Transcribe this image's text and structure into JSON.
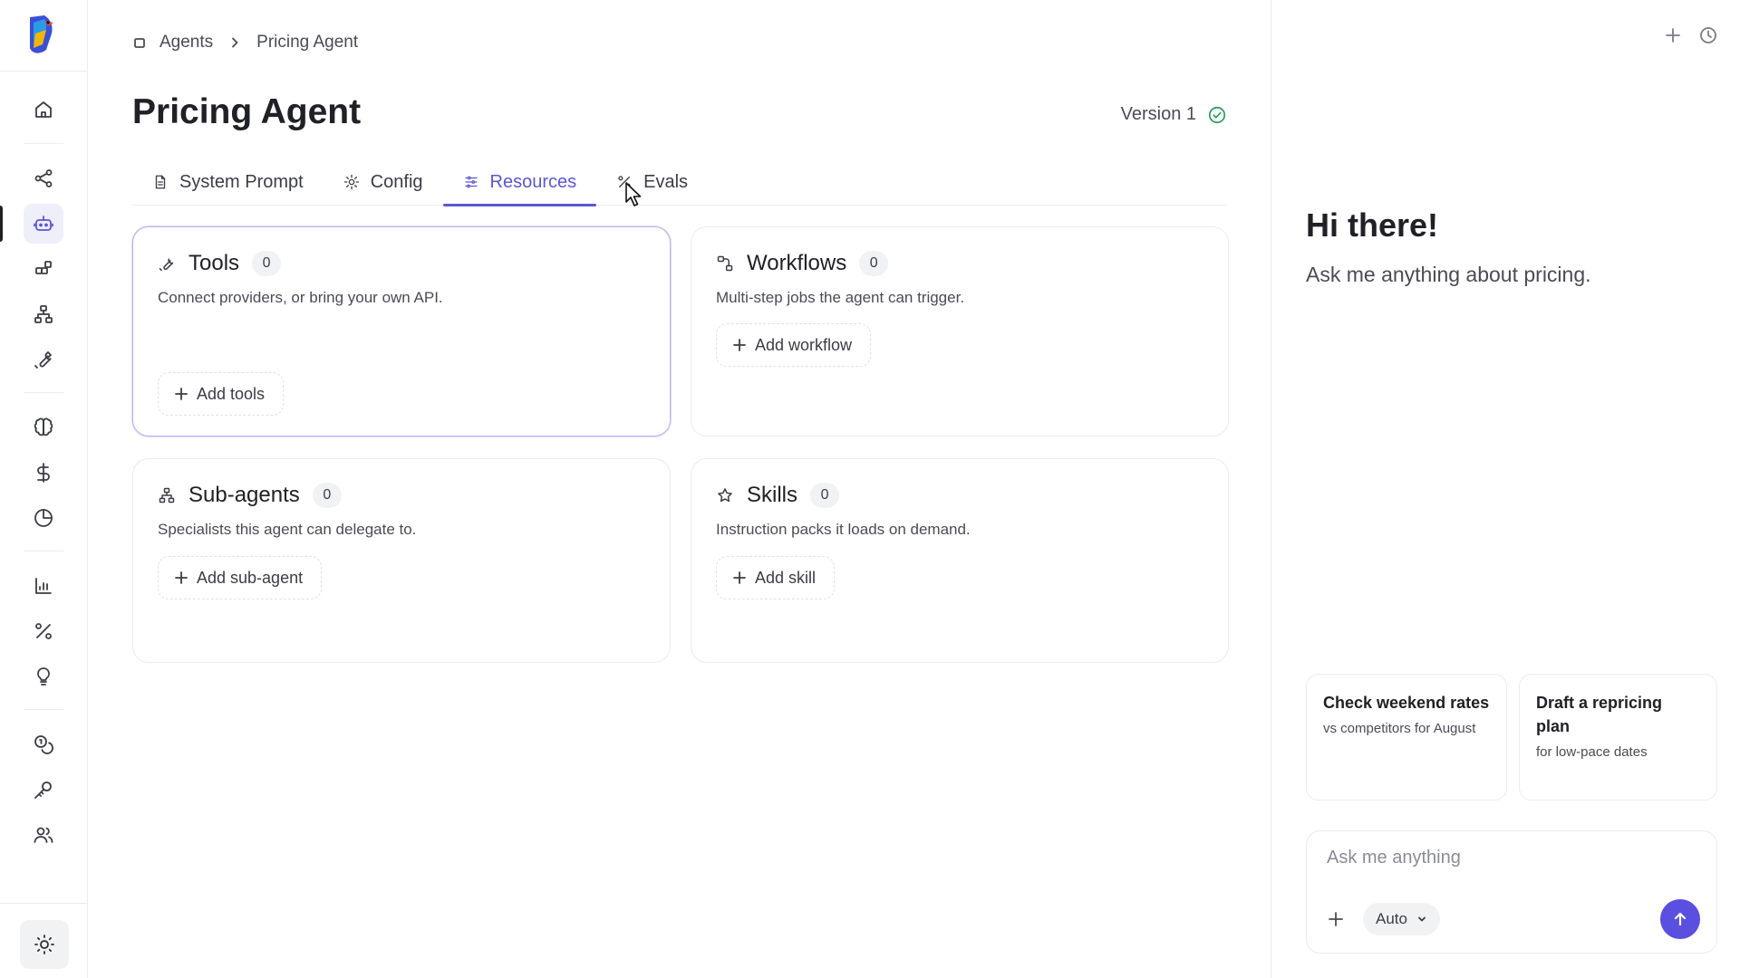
{
  "breadcrumb": {
    "root": "Agents",
    "current": "Pricing Agent"
  },
  "page": {
    "title": "Pricing Agent",
    "version": "Version 1"
  },
  "tabs": [
    {
      "label": "System Prompt",
      "icon": "file-icon"
    },
    {
      "label": "Config",
      "icon": "gear-icon"
    },
    {
      "label": "Resources",
      "icon": "sliders-icon",
      "active": true
    },
    {
      "label": "Evals",
      "icon": "percent-icon"
    }
  ],
  "resources": {
    "tools": {
      "title": "Tools",
      "count": "0",
      "description": "Connect providers, or bring your own API.",
      "button": "Add tools"
    },
    "workflows": {
      "title": "Workflows",
      "count": "0",
      "description": "Multi-step jobs the agent can trigger.",
      "button": "Add workflow"
    },
    "subagents": {
      "title": "Sub-agents",
      "count": "0",
      "description": "Specialists this agent can delegate to.",
      "button": "Add sub-agent"
    },
    "skills": {
      "title": "Skills",
      "count": "0",
      "description": "Instruction packs it loads on demand.",
      "button": "Add skill"
    }
  },
  "assistant": {
    "greeting": "Hi there!",
    "subtitle": "Ask me anything about pricing.",
    "suggestions": [
      {
        "title": "Check weekend rates",
        "subtitle": "vs competitors for August"
      },
      {
        "title": "Draft a repricing plan",
        "subtitle": "for low-pace dates"
      }
    ],
    "input_placeholder": "Ask me anything",
    "mode": "Auto"
  },
  "colors": {
    "accent": "#5b56d6",
    "send_button": "#5b4fe0",
    "success": "#1f9d55"
  },
  "sidebar_icons": [
    "home-icon",
    "share-icon",
    "bot-icon",
    "blocks-icon",
    "hierarchy-icon",
    "wrench-icon",
    "brain-icon",
    "dollar-icon",
    "pie-chart-icon",
    "bar-chart-icon",
    "percent-icon",
    "lightbulb-icon",
    "coins-icon",
    "key-icon",
    "users-icon",
    "sun-icon"
  ]
}
